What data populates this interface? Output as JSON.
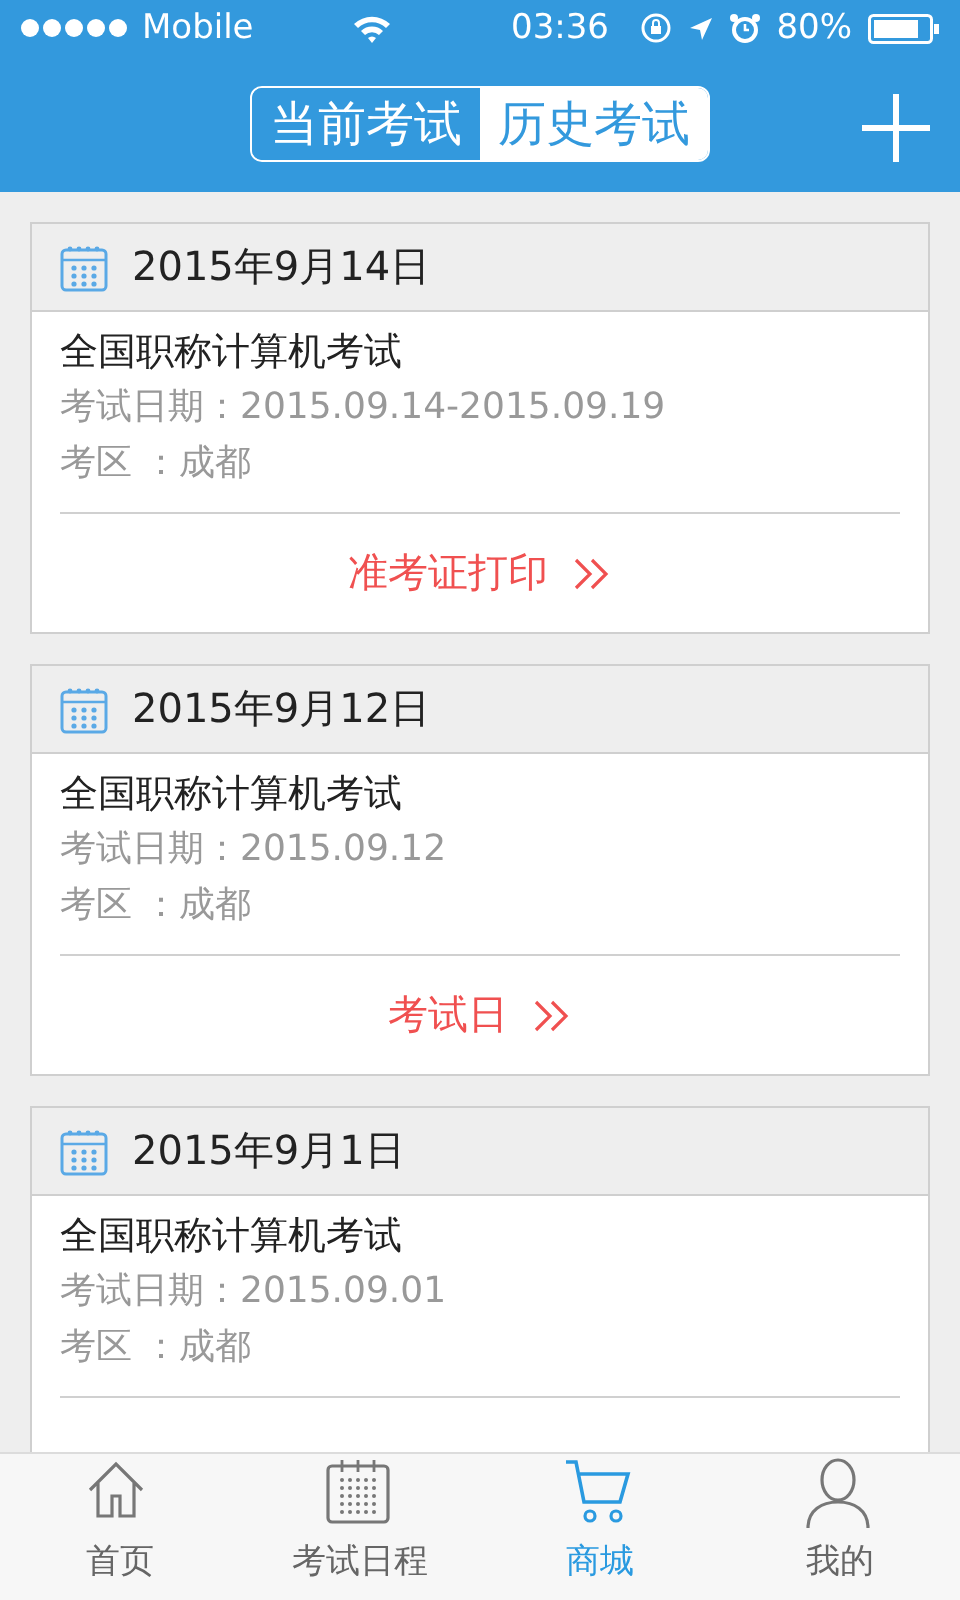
{
  "status_bar": {
    "carrier": "Mobile",
    "time": "03:36",
    "battery": "80%"
  },
  "header": {
    "segments": [
      {
        "label": "当前考试",
        "selected": false
      },
      {
        "label": "历史考试",
        "selected": true
      }
    ]
  },
  "exams": [
    {
      "date": "2015年9月14日",
      "title": "全国职称计算机考试",
      "exam_date": "考试日期：2015.09.14-2015.09.19",
      "area": "考区 ：成都",
      "action": "准考证打印"
    },
    {
      "date": "2015年9月12日",
      "title": "全国职称计算机考试",
      "exam_date": "考试日期：2015.09.12",
      "area": "考区 ：成都",
      "action": "考试日"
    },
    {
      "date": "2015年9月1日",
      "title": "全国职称计算机考试",
      "exam_date": "考试日期：2015.09.01",
      "area": "考区 ：成都"
    }
  ],
  "tab_bar": [
    {
      "kind": "home",
      "label": "首页",
      "selected": false
    },
    {
      "kind": "calendar",
      "label": "考试日程",
      "selected": false
    },
    {
      "kind": "cart",
      "label": "商城",
      "selected": true
    },
    {
      "kind": "person",
      "label": "我的",
      "selected": false
    }
  ]
}
